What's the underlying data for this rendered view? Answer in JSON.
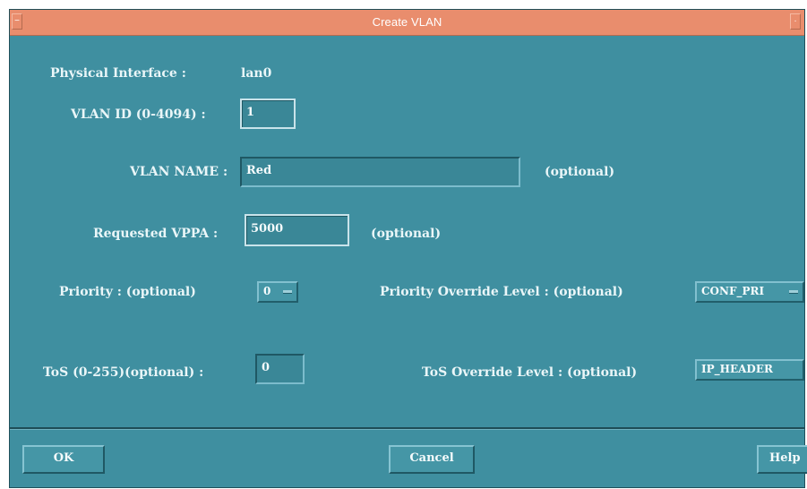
{
  "window": {
    "title": "Create VLAN"
  },
  "form": {
    "physical_interface": {
      "label": "Physical Interface :",
      "value": "lan0"
    },
    "vlan_id": {
      "label": "VLAN ID (0-4094) :",
      "value": "1"
    },
    "vlan_name": {
      "label": "VLAN NAME :",
      "value": "Red",
      "hint": "(optional)"
    },
    "requested_vppa": {
      "label": "Requested VPPA :",
      "value": "5000",
      "hint": "(optional)"
    },
    "priority": {
      "label": "Priority : (optional)",
      "selected": "0"
    },
    "priority_override": {
      "label": "Priority Override Level : (optional)",
      "selected": "CONF_PRI"
    },
    "tos": {
      "label": "ToS (0-255)(optional) :",
      "value": "0"
    },
    "tos_override": {
      "label": "ToS Override Level : (optional)",
      "selected": "IP_HEADER"
    }
  },
  "buttons": {
    "ok": "OK",
    "cancel": "Cancel",
    "help": "Help"
  },
  "colors": {
    "dialog_background": "#3f8fa0",
    "titlebar": "#e98d6d",
    "text": "#eaf6f8"
  },
  "icons": {
    "window_menu": "minus-icon",
    "window_control": "dot-icon"
  }
}
